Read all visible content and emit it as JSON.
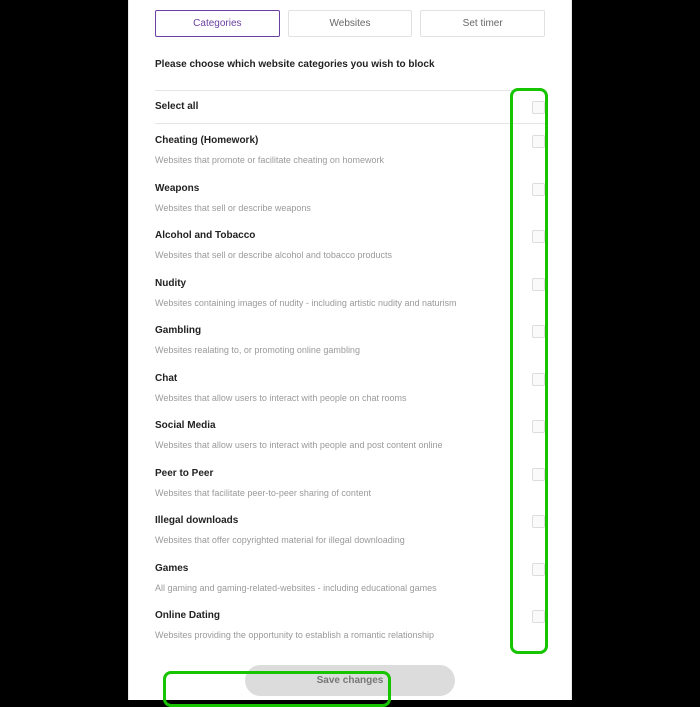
{
  "tabs": {
    "categories": "Categories",
    "websites": "Websites",
    "timer": "Set timer"
  },
  "instruction": "Please choose which website categories you wish to block",
  "select_all": "Select all",
  "items": [
    {
      "title": "Cheating (Homework)",
      "desc": "Websites that promote or facilitate cheating on homework"
    },
    {
      "title": "Weapons",
      "desc": "Websites that sell or describe weapons"
    },
    {
      "title": "Alcohol and Tobacco",
      "desc": "Websites that sell or describe alcohol and tobacco products"
    },
    {
      "title": "Nudity",
      "desc": "Websites containing images of nudity - including artistic nudity and naturism"
    },
    {
      "title": "Gambling",
      "desc": "Websites realating to, or promoting online gambling"
    },
    {
      "title": "Chat",
      "desc": "Websites that allow users to interact with people on chat rooms"
    },
    {
      "title": "Social Media",
      "desc": "Websites that allow users to interact with people and post content online"
    },
    {
      "title": "Peer to Peer",
      "desc": "Websites that facilitate peer-to-peer sharing of content"
    },
    {
      "title": "Illegal downloads",
      "desc": "Websites that offer copyrighted material for illegal downloading"
    },
    {
      "title": "Games",
      "desc": "All gaming and gaming-related-websites - including educational games"
    },
    {
      "title": "Online Dating",
      "desc": "Websites providing the opportunity to establish a romantic relationship"
    }
  ],
  "save": "Save changes",
  "colors": {
    "accent": "#6b3fa0",
    "highlight": "#17c400"
  }
}
